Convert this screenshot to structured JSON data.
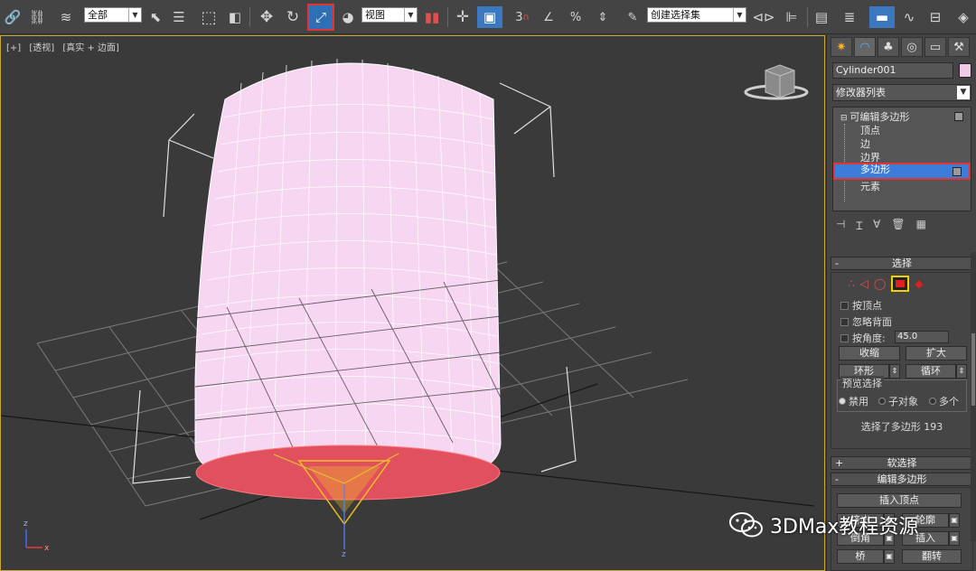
{
  "toolbar": {
    "selection_filter": "全部",
    "coord_system": "视图",
    "snap_label": "3",
    "named_selection_set": "创建选择集"
  },
  "viewport": {
    "labels": [
      "[+]",
      "[透视]",
      "[真实 + 边面]"
    ],
    "axis_z": "z",
    "axis_x": "x",
    "gizmo_z": "z"
  },
  "panel": {
    "object_name": "Cylinder001",
    "object_color": "#f1c8e6",
    "modifier_list": "修改器列表",
    "stack": {
      "root": "可编辑多边形",
      "children": [
        "顶点",
        "边",
        "边界",
        "多边形",
        "元素"
      ],
      "selected_index": 3
    },
    "selection": {
      "title": "选择",
      "by_vertex": "按顶点",
      "ignore_backfacing": "忽略背面",
      "by_angle": "按角度:",
      "angle_value": "45.0",
      "shrink": "收缩",
      "grow": "扩大",
      "ring": "环形",
      "loop": "循环",
      "preview_title": "预览选择",
      "preview_options": [
        "禁用",
        "子对象",
        "多个"
      ],
      "status": "选择了多边形 193"
    },
    "soft_selection": "软选择",
    "edit_polygons": {
      "title": "编辑多边形",
      "insert_vertex": "插入顶点",
      "extrude": "挤出",
      "outline": "轮廓",
      "bevel": "倒角",
      "inset": "插入",
      "bridge": "桥",
      "flip": "翻转"
    }
  },
  "watermark": "3DMax教程资源",
  "colors": {
    "accent": "#3b7dd8",
    "highlight": "#e03535",
    "cylinder": "#f6d6f0",
    "selected_face": "#e0505f"
  }
}
